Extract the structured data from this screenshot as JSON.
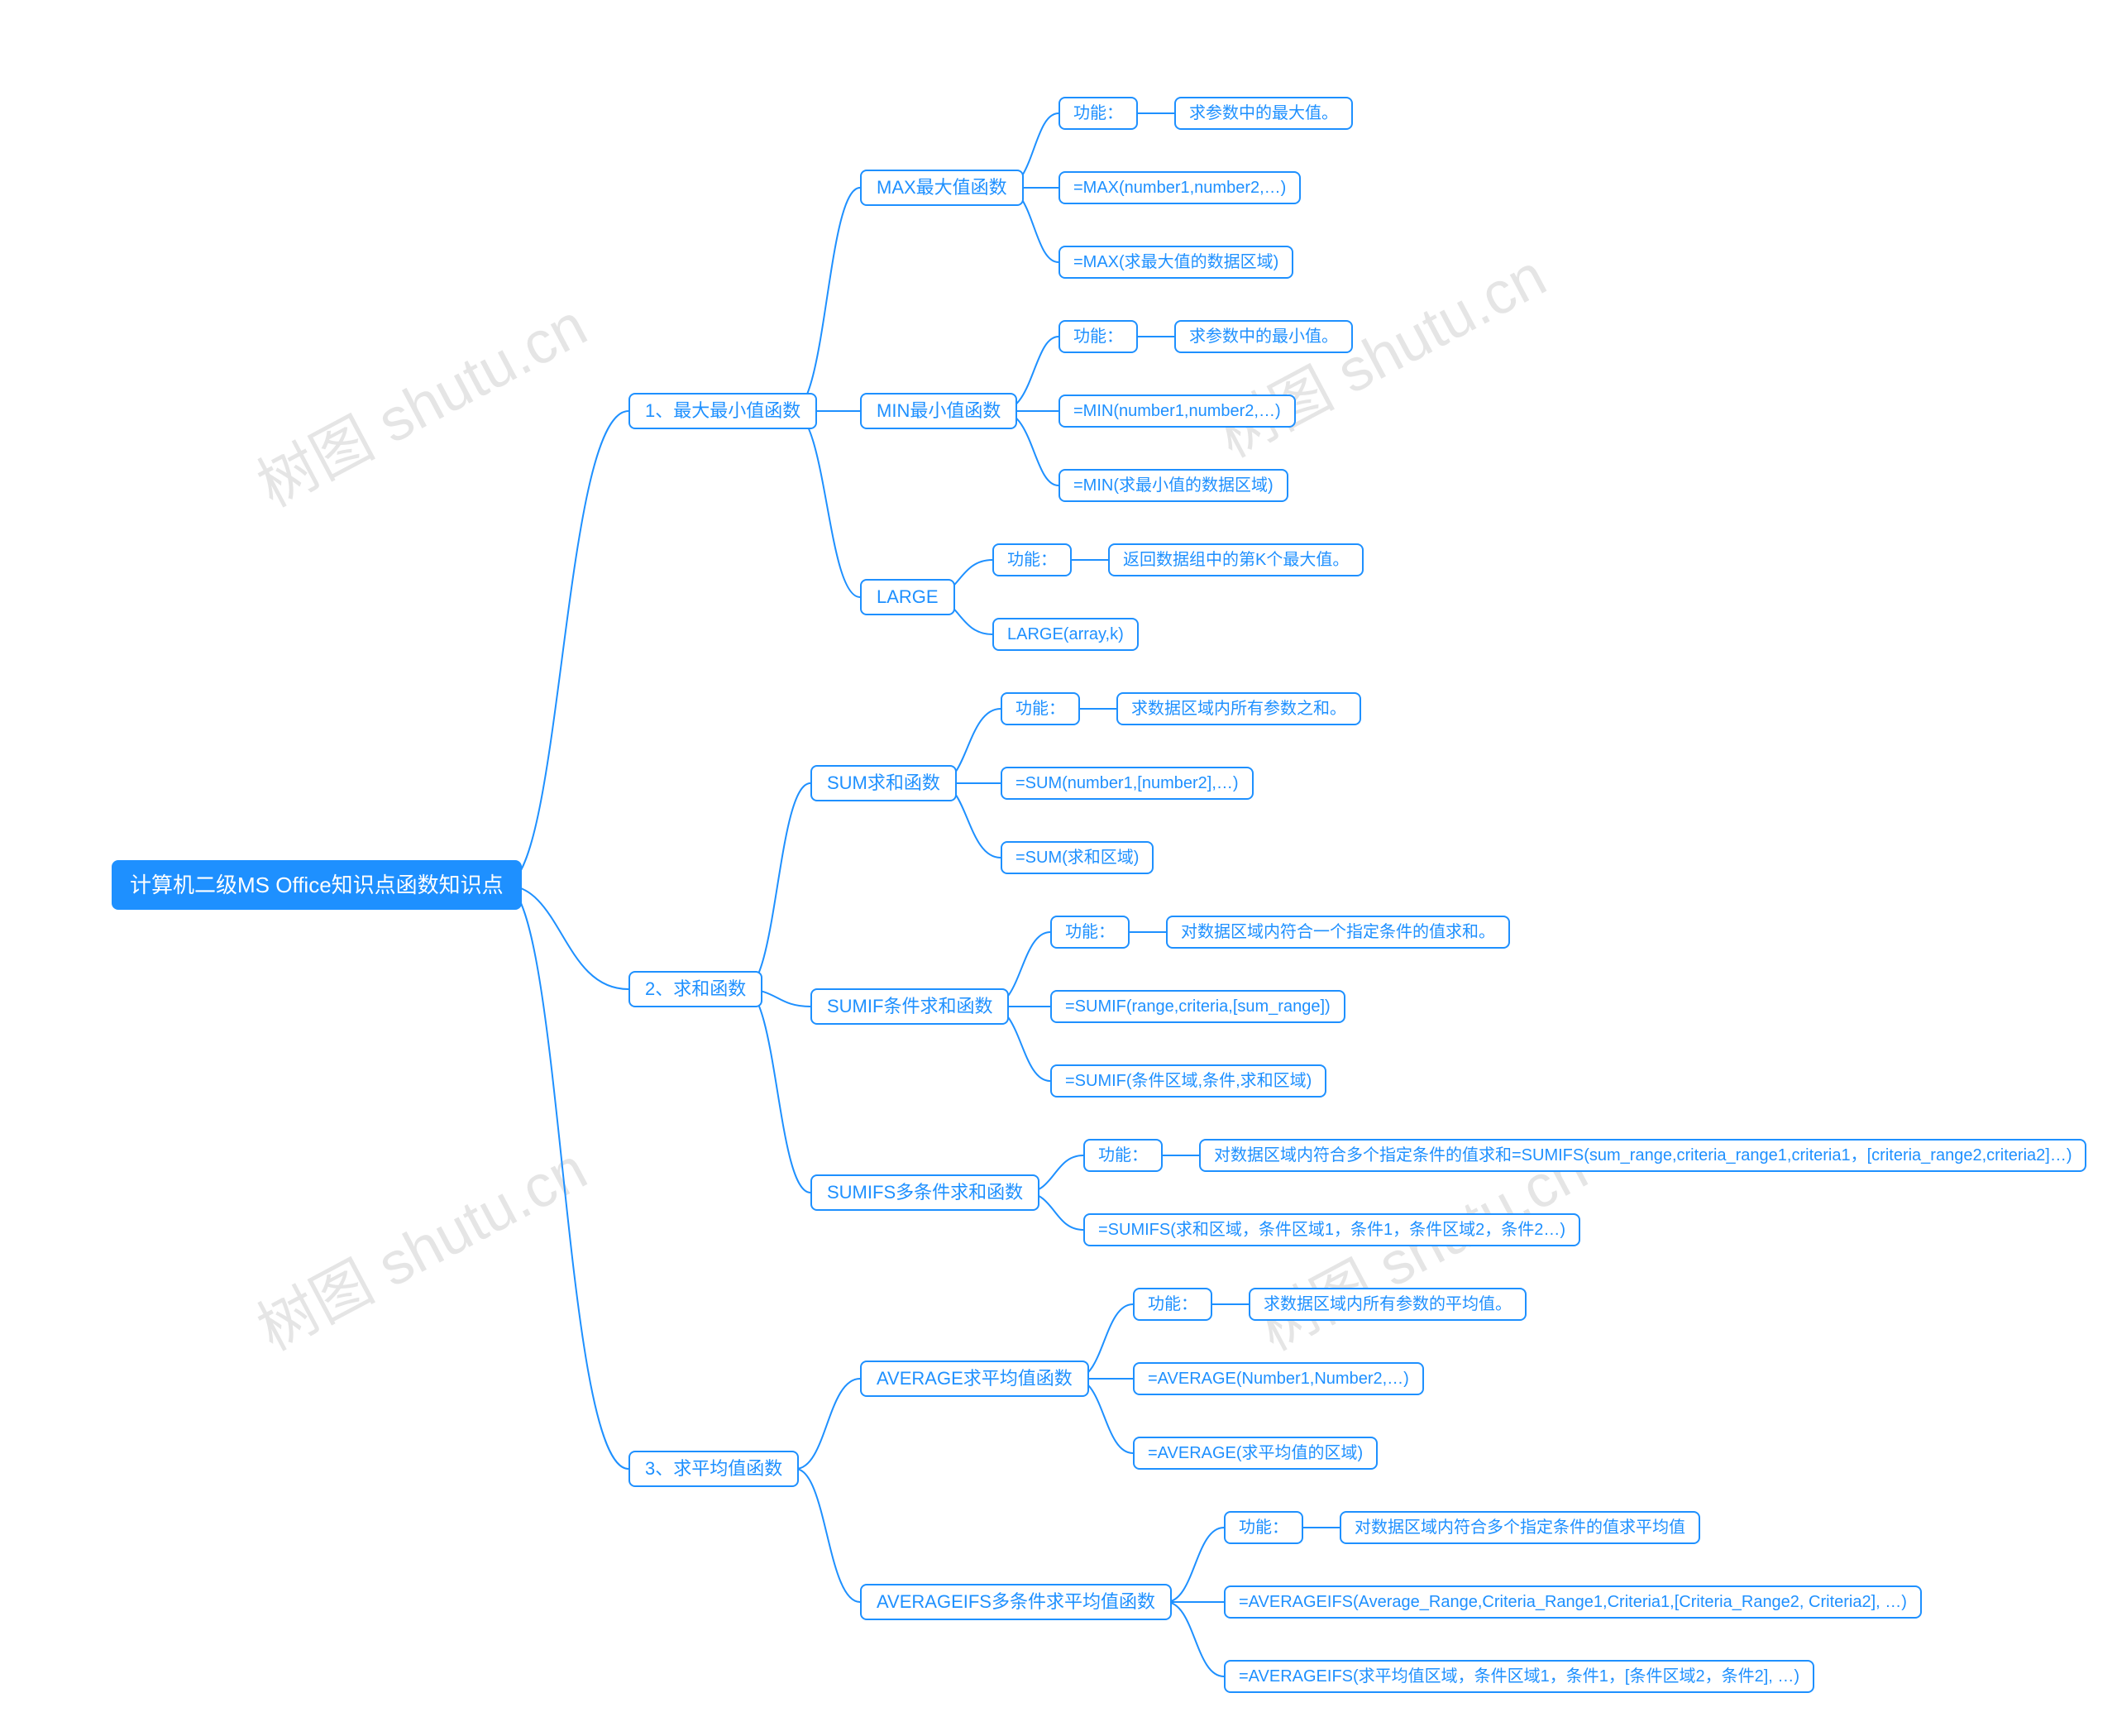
{
  "watermark": "树图 shutu.cn",
  "root": {
    "label": "计算机二级MS Office知识点函数知识点"
  },
  "branches": [
    {
      "id": "b1",
      "label": "1、最大最小值函数",
      "children": [
        {
          "id": "b1c1",
          "label": "MAX最大值函数",
          "children": [
            {
              "id": "b1c1a",
              "label": "功能：",
              "children": [
                {
                  "id": "b1c1a1",
                  "label": "求参数中的最大值。"
                }
              ]
            },
            {
              "id": "b1c1b",
              "label": "=MAX(number1,number2,…)"
            },
            {
              "id": "b1c1c",
              "label": "=MAX(求最大值的数据区域)"
            }
          ]
        },
        {
          "id": "b1c2",
          "label": "MIN最小值函数",
          "children": [
            {
              "id": "b1c2a",
              "label": "功能：",
              "children": [
                {
                  "id": "b1c2a1",
                  "label": "求参数中的最小值。"
                }
              ]
            },
            {
              "id": "b1c2b",
              "label": "=MIN(number1,number2,…)"
            },
            {
              "id": "b1c2c",
              "label": "=MIN(求最小值的数据区域)"
            }
          ]
        },
        {
          "id": "b1c3",
          "label": "LARGE",
          "children": [
            {
              "id": "b1c3a",
              "label": "功能：",
              "children": [
                {
                  "id": "b1c3a1",
                  "label": "返回数据组中的第K个最大值。"
                }
              ]
            },
            {
              "id": "b1c3b",
              "label": "LARGE(array,k)"
            }
          ]
        }
      ]
    },
    {
      "id": "b2",
      "label": "2、求和函数",
      "children": [
        {
          "id": "b2c1",
          "label": "SUM求和函数",
          "children": [
            {
              "id": "b2c1a",
              "label": "功能：",
              "children": [
                {
                  "id": "b2c1a1",
                  "label": "求数据区域内所有参数之和。"
                }
              ]
            },
            {
              "id": "b2c1b",
              "label": "=SUM(number1,[number2],…)"
            },
            {
              "id": "b2c1c",
              "label": "=SUM(求和区域)"
            }
          ]
        },
        {
          "id": "b2c2",
          "label": "SUMIF条件求和函数",
          "children": [
            {
              "id": "b2c2a",
              "label": "功能：",
              "children": [
                {
                  "id": "b2c2a1",
                  "label": "对数据区域内符合一个指定条件的值求和。"
                }
              ]
            },
            {
              "id": "b2c2b",
              "label": "=SUMIF(range,criteria,[sum_range])"
            },
            {
              "id": "b2c2c",
              "label": "=SUMIF(条件区域,条件,求和区域)"
            }
          ]
        },
        {
          "id": "b2c3",
          "label": "SUMIFS多条件求和函数",
          "children": [
            {
              "id": "b2c3a",
              "label": "功能：",
              "children": [
                {
                  "id": "b2c3a1",
                  "label": "对数据区域内符合多个指定条件的值求和=SUMIFS(sum_range,criteria_range1,criteria1，[criteria_range2,criteria2]…)"
                }
              ]
            },
            {
              "id": "b2c3b",
              "label": "=SUMIFS(求和区域，条件区域1，条件1，条件区域2，条件2…)"
            }
          ]
        }
      ]
    },
    {
      "id": "b3",
      "label": "3、求平均值函数",
      "children": [
        {
          "id": "b3c1",
          "label": "AVERAGE求平均值函数",
          "children": [
            {
              "id": "b3c1a",
              "label": "功能：",
              "children": [
                {
                  "id": "b3c1a1",
                  "label": "求数据区域内所有参数的平均值。"
                }
              ]
            },
            {
              "id": "b3c1b",
              "label": "=AVERAGE(Number1,Number2,…)"
            },
            {
              "id": "b3c1c",
              "label": "=AVERAGE(求平均值的区域)"
            }
          ]
        },
        {
          "id": "b3c2",
          "label": "AVERAGEIFS多条件求平均值函数",
          "children": [
            {
              "id": "b3c2a",
              "label": "功能：",
              "children": [
                {
                  "id": "b3c2a1",
                  "label": "对数据区域内符合多个指定条件的值求平均值"
                }
              ]
            },
            {
              "id": "b3c2b",
              "label": "=AVERAGEIFS(Average_Range,Criteria_Range1,Criteria1,[Criteria_Range2, Criteria2], …)"
            },
            {
              "id": "b3c2c",
              "label": "=AVERAGEIFS(求平均值区域，条件区域1，条件1，[条件区域2，条件2], …)"
            }
          ]
        }
      ]
    }
  ],
  "layout_hint": {
    "colors": {
      "node_border": "#1e90ff",
      "root_bg": "#1e90ff",
      "root_text": "#ffffff",
      "node_text": "#1e90ff",
      "bg": "#ffffff"
    }
  }
}
